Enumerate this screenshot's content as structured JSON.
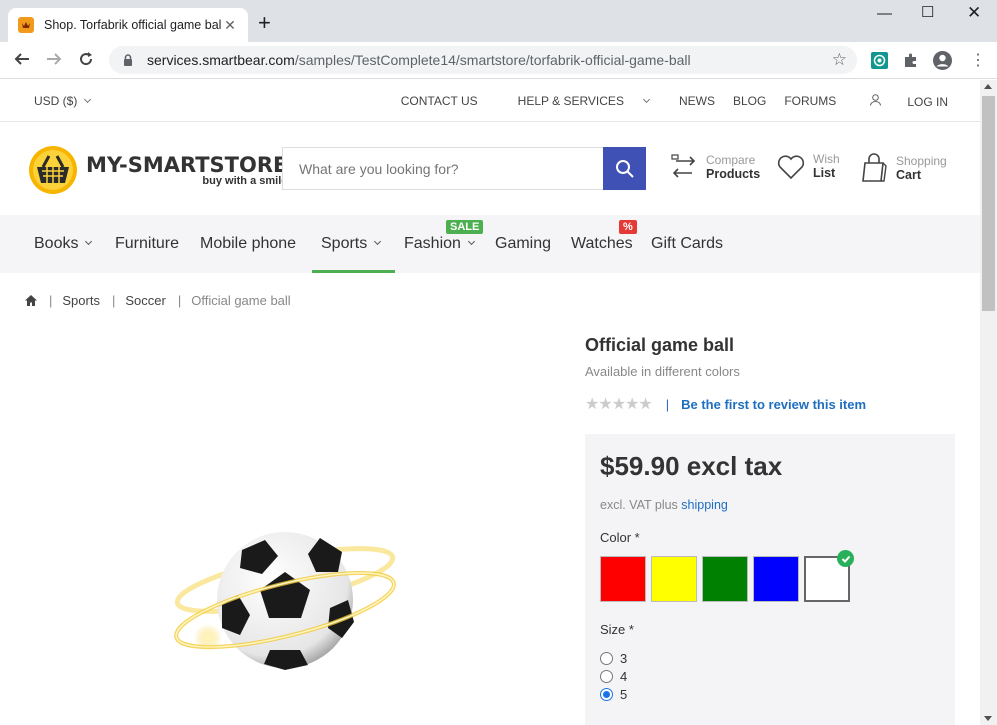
{
  "browser": {
    "tab_title": "Shop. Torfabrik official game ball",
    "url_host": "services.smartbear.com",
    "url_path": "/samples/TestComplete14/smartstore/torfabrik-official-game-ball"
  },
  "topbar": {
    "currency": "USD  ($)",
    "links": [
      "CONTACT US",
      "HELP & SERVICES",
      "NEWS",
      "BLOG",
      "FORUMS",
      "LOG IN"
    ]
  },
  "logo": {
    "main": "MY-SMARTSTORE",
    "sub": "buy with a smile"
  },
  "search": {
    "placeholder": "What are you looking for?"
  },
  "header_actions": {
    "compare": {
      "small": "Compare",
      "big": "Products"
    },
    "wish": {
      "small": "Wish",
      "big": "List"
    },
    "cart": {
      "small": "Shopping",
      "big": "Cart"
    }
  },
  "menu": {
    "items": [
      "Books",
      "Furniture",
      "Mobile phone",
      "Sports",
      "Fashion",
      "Gaming",
      "Watches",
      "Gift Cards"
    ],
    "badges": {
      "fashion": "SALE",
      "watches": "%"
    }
  },
  "breadcrumb": {
    "items": [
      "Sports",
      "Soccer"
    ],
    "current": "Official game ball"
  },
  "product": {
    "title": "Official game ball",
    "subtitle": "Available in different colors",
    "review_link": "Be the first to review this item",
    "review_sep": "|",
    "stars": "★★★★★",
    "rating": 0,
    "price": "$59.90 excl tax",
    "vat_text": "excl. VAT plus",
    "shipping_link": "shipping",
    "color_label": "Color *",
    "colors": [
      "#ff0000",
      "#ffff00",
      "#008000",
      "#0000ff",
      "#ffffff"
    ],
    "selected_color_index": 4,
    "size_label": "Size *",
    "sizes": [
      "3",
      "4",
      "5"
    ],
    "selected_size": "5"
  },
  "colors": {
    "accent": "#3f51b5",
    "active_underline": "#4caf50",
    "link": "#1e6fc0",
    "sale_badge": "#4caf50",
    "percent_badge": "#e53935"
  }
}
